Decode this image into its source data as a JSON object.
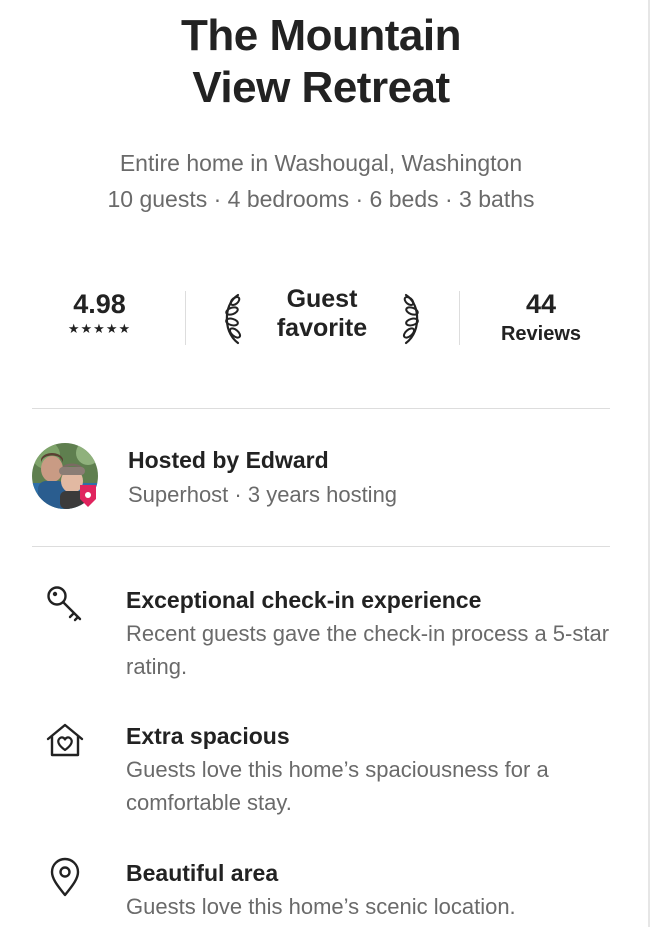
{
  "listing": {
    "title_line1": "The Mountain",
    "title_line2": "View Retreat",
    "location": "Entire home in Washougal, Washington",
    "details": "10 guests · 4 bedrooms · 6 beds · 3 baths"
  },
  "stats": {
    "rating": "4.98",
    "stars": "★★★★★",
    "badge_line1": "Guest",
    "badge_line2": "favorite",
    "reviews_count": "44",
    "reviews_label": "Reviews"
  },
  "host": {
    "name": "Hosted by Edward",
    "meta": "Superhost · 3 years hosting"
  },
  "highlights": [
    {
      "icon": "key-icon",
      "title": "Exceptional check-in experience",
      "description": "Recent guests gave the check-in process a 5-star rating."
    },
    {
      "icon": "home-heart-icon",
      "title": "Extra spacious",
      "description": "Guests love this home’s spaciousness for a comfortable stay."
    },
    {
      "icon": "location-pin-icon",
      "title": "Beautiful area",
      "description": "Guests love this home’s scenic location."
    }
  ],
  "colors": {
    "primary_text": "#222222",
    "secondary_text": "#6a6a6a",
    "divider": "#dddddd",
    "superhost_accent": "#e0245e"
  }
}
